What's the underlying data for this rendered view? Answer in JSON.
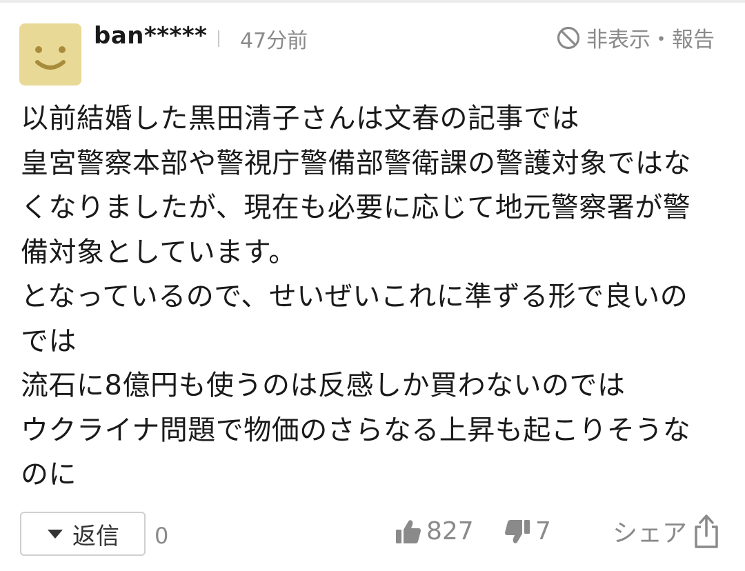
{
  "comment": {
    "username": "ban*****",
    "time": "47分前",
    "hide_report_label": "非表示・報告",
    "avatar_icon": "smiley-face-icon",
    "avatar_color": "#e9d996",
    "lines": [
      "以前結婚した黒田清子さんは文春の記事では",
      "皇宮警察本部や警視庁警備部警衛課の警護対象ではな",
      "くなりましたが、現在も必要に応じて地元警察署が警",
      "備対象としています。",
      "となっているので、せいぜいこれに準ずる形で良いの",
      "では",
      "流石に8億円も使うのは反感しか買わないのでは",
      "ウクライナ問題で物価のさらなる上昇も起こりそうな",
      "のに"
    ]
  },
  "actions": {
    "reply_label": "返信",
    "reply_count": "0",
    "likes": "827",
    "dislikes": "7",
    "share_label": "シェア"
  }
}
